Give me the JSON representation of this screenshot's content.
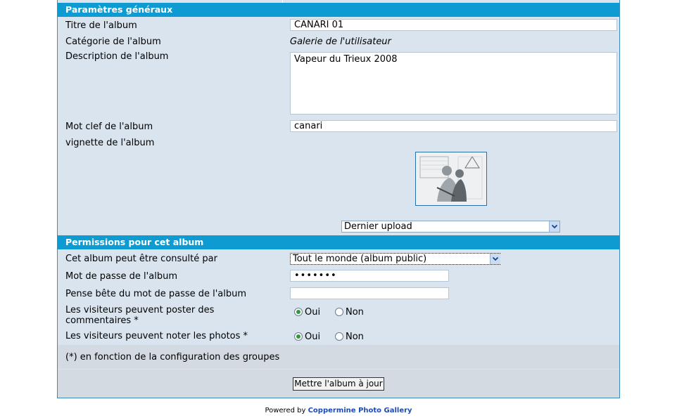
{
  "general": {
    "header": "Paramètres généraux",
    "title_label": "Titre de l'album",
    "title_value": "CANARI 01",
    "category_label": "Catégorie de l'album",
    "category_value": "Galerie de l'utilisateur",
    "description_label": "Description de l'album",
    "description_value": "Vapeur du Trieux 2008",
    "keyword_label": "Mot clef de l'album",
    "keyword_value": "canari",
    "thumbnail_label": "vignette de l'album",
    "thumbnail_select": "Dernier upload"
  },
  "permissions": {
    "header": "Permissions pour cet album",
    "visibility_label": "Cet album peut être consulté par",
    "visibility_value": "Tout le monde (album public)",
    "password_label": "Mot de passe de l'album",
    "password_value": "•••••••",
    "hint_label": "Pense bête du mot de passe de l'album",
    "hint_value": "",
    "comments_label": "Les visiteurs peuvent poster des commentaires *",
    "rating_label": "Les visiteurs peuvent noter les photos *",
    "yes_label": "Oui",
    "no_label": "Non"
  },
  "footnote": "(*) en fonction de la configuration des groupes",
  "submit_label": "Mettre l'album à jour",
  "powered_by": "Powered by",
  "powered_link": "Coppermine Photo Gallery",
  "colors": {
    "header_bg": "#0e9bd2",
    "panel_bg": "#d9e4ef",
    "link": "#1c4bb5"
  },
  "icons": {
    "select_arrow": "chevron-down-icon"
  }
}
